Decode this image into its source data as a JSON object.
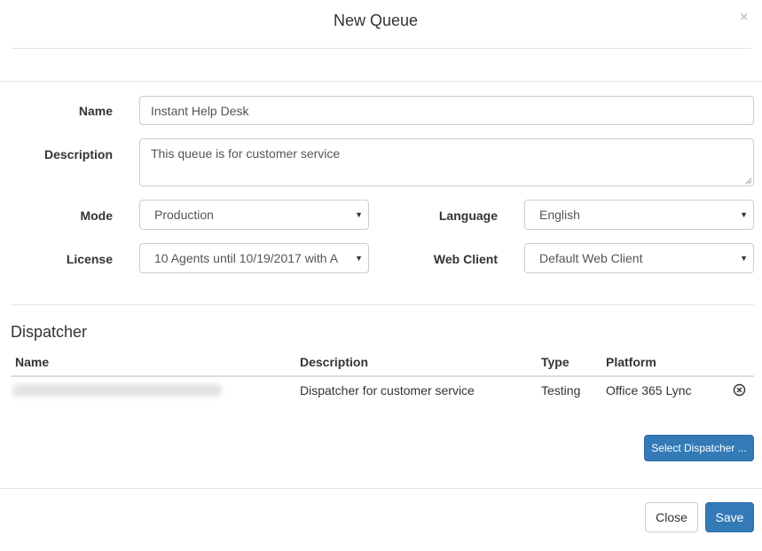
{
  "modal": {
    "title": "New Queue",
    "close_symbol": "×"
  },
  "form": {
    "name_label": "Name",
    "name_value": "Instant Help Desk",
    "description_label": "Description",
    "description_value": "This queue is for customer service",
    "mode_label": "Mode",
    "mode_value": "Production",
    "language_label": "Language",
    "language_value": "English",
    "license_label": "License",
    "license_value": "10 Agents until 10/19/2017 with A",
    "webclient_label": "Web Client",
    "webclient_value": "Default Web Client",
    "caret_symbol": "▼"
  },
  "dispatcher": {
    "section_title": "Dispatcher",
    "columns": [
      "Name",
      "Description",
      "Type",
      "Platform"
    ],
    "rows": [
      {
        "name": "",
        "description": "Dispatcher for customer service",
        "type": "Testing",
        "platform": "Office 365 Lync"
      }
    ],
    "select_button_label": "Select Dispatcher ..."
  },
  "footer": {
    "close_label": "Close",
    "save_label": "Save"
  },
  "colors": {
    "primary": "#337ab7",
    "border": "#cccccc",
    "divider": "#e5e5e5"
  },
  "icons": {
    "close": "close-icon",
    "dropdown": "chevron-down-icon",
    "remove": "circle-x-icon"
  }
}
